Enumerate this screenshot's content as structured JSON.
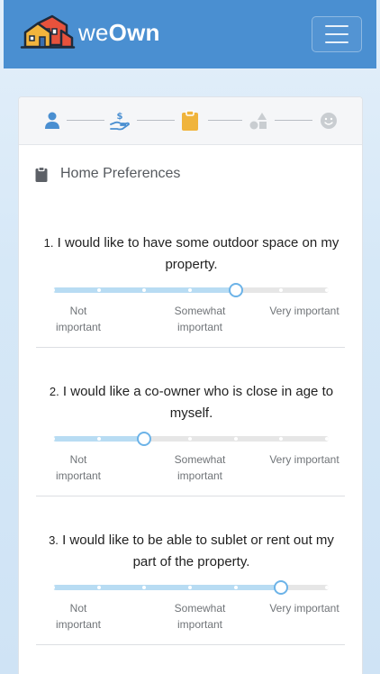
{
  "navbar": {
    "brand_light": "we",
    "brand_bold": "Own"
  },
  "stepper": {
    "steps": [
      {
        "icon": "user-icon",
        "state": "done"
      },
      {
        "icon": "hand-money-icon",
        "state": "done"
      },
      {
        "icon": "clipboard-icon",
        "state": "active"
      },
      {
        "icon": "shapes-icon",
        "state": "pending"
      },
      {
        "icon": "smiley-icon",
        "state": "pending"
      }
    ],
    "colors": {
      "done": "#4a8fd1",
      "active": "#f0b43c",
      "pending": "#c9cdd1"
    }
  },
  "section": {
    "title": "Home Preferences"
  },
  "scale_labels": {
    "low": "Not important",
    "mid_line1": "Somewhat",
    "mid_line2": "important",
    "high": "Very important"
  },
  "questions": [
    {
      "num": "1.",
      "text": "I would like to have some outdoor space on my property.",
      "value": 4,
      "max": 6
    },
    {
      "num": "2.",
      "text": "I would like a co-owner who is close in age to myself.",
      "value": 2,
      "max": 6
    },
    {
      "num": "3.",
      "text": "I would like to be able to sublet or rent out my part of the property.",
      "value": 5,
      "max": 6
    }
  ]
}
